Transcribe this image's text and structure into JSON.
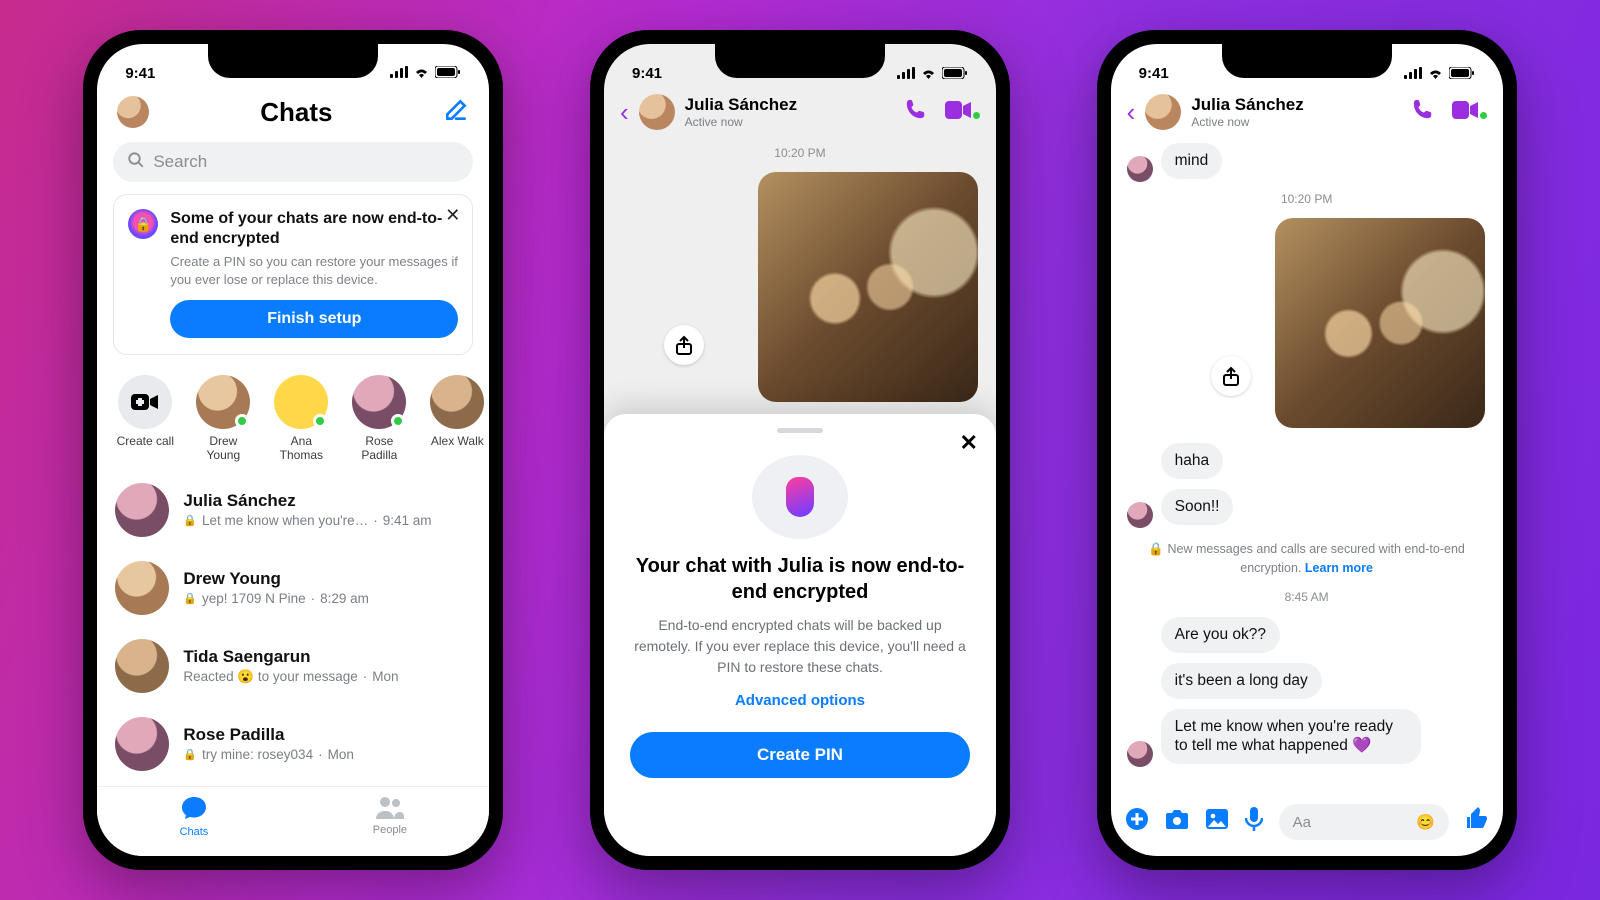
{
  "status": {
    "time": "9:41"
  },
  "phone1": {
    "title": "Chats",
    "search_placeholder": "Search",
    "banner": {
      "title": "Some of your chats are now end-to-end encrypted",
      "body": "Create a PIN so you can restore your messages if you ever lose or replace this device.",
      "cta": "Finish setup"
    },
    "tray": [
      {
        "label": "Create call"
      },
      {
        "label": "Drew Young"
      },
      {
        "label": "Ana Thomas"
      },
      {
        "label": "Rose Padilla"
      },
      {
        "label": "Alex Walk"
      }
    ],
    "chats": [
      {
        "name": "Julia Sánchez",
        "preview": "Let me know when you're…",
        "time": "9:41 am",
        "locked": true
      },
      {
        "name": "Drew Young",
        "preview": "yep! 1709 N Pine",
        "time": "8:29 am",
        "locked": true
      },
      {
        "name": "Tida Saengarun",
        "preview": "Reacted 😮 to your message",
        "time": "Mon",
        "locked": false
      },
      {
        "name": "Rose Padilla",
        "preview": "try mine: rosey034",
        "time": "Mon",
        "locked": true
      }
    ],
    "tabs": {
      "chats": "Chats",
      "people": "People"
    }
  },
  "phone2": {
    "contact": {
      "name": "Julia Sánchez",
      "status": "Active now"
    },
    "timestamp": "10:20 PM",
    "sheet": {
      "title": "Your chat with Julia is now end-to-end encrypted",
      "body": "End-to-end encrypted chats will be backed up remotely. If you ever replace this device, you'll need a PIN to restore these chats.",
      "advanced": "Advanced options",
      "cta": "Create PIN"
    }
  },
  "phone3": {
    "contact": {
      "name": "Julia Sánchez",
      "status": "Active now"
    },
    "msg_mind": "mind",
    "timestamp1": "10:20 PM",
    "msg_haha": "haha",
    "msg_soon": "Soon!!",
    "e2e_note": "New messages and calls are secured with end-to-end encryption.",
    "e2e_link": "Learn more",
    "timestamp2": "8:45 AM",
    "msg_ok": "Are you ok??",
    "msg_long": "it's been a long day",
    "msg_ready": "Let me know when you're ready to tell me what happened 💜",
    "composer_placeholder": "Aa"
  }
}
